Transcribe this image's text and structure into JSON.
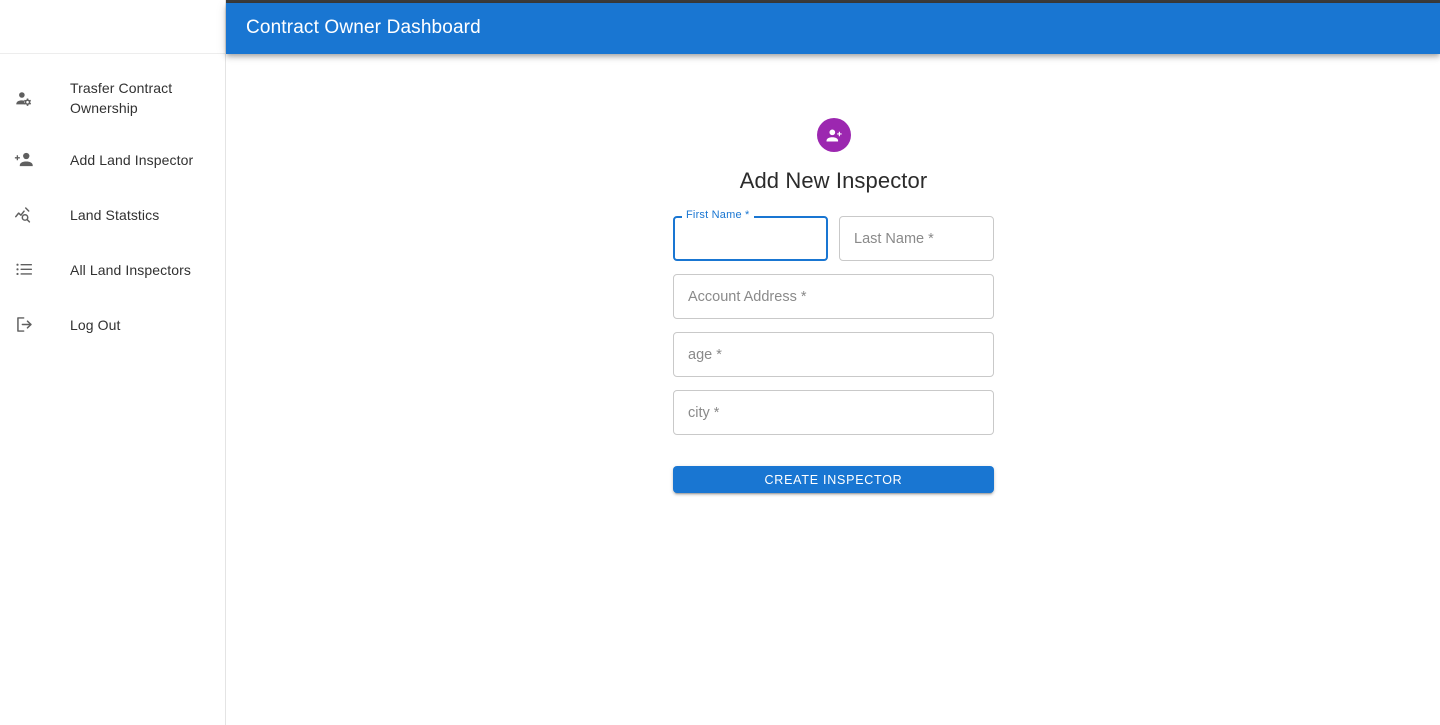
{
  "appbar": {
    "title": "Contract Owner Dashboard",
    "background_color": "#1976d2",
    "text_color": "#ffffff"
  },
  "sidebar": {
    "items": [
      {
        "label": "Trasfer Contract Ownership",
        "icon": "person-settings-icon"
      },
      {
        "label": "Add Land Inspector",
        "icon": "person-add-icon"
      },
      {
        "label": "Land Statstics",
        "icon": "analytics-search-icon"
      },
      {
        "label": "All Land Inspectors",
        "icon": "list-icon"
      },
      {
        "label": "Log Out",
        "icon": "logout-icon"
      }
    ]
  },
  "form": {
    "avatar_icon": "person-add-icon",
    "avatar_color": "#9c27b0",
    "title": "Add New Inspector",
    "fields": [
      {
        "name": "first-name",
        "label": "First Name *",
        "placeholder": "",
        "value": "",
        "focused": true
      },
      {
        "name": "last-name",
        "label": "Last Name *",
        "placeholder": "Last Name *",
        "value": "",
        "focused": false
      },
      {
        "name": "account-address",
        "label": "Account Address *",
        "placeholder": "Account Address *",
        "value": "",
        "focused": false
      },
      {
        "name": "age",
        "label": "age *",
        "placeholder": "age *",
        "value": "",
        "focused": false
      },
      {
        "name": "city",
        "label": "city *",
        "placeholder": "city *",
        "value": "",
        "focused": false
      }
    ],
    "submit_label": "CREATE INSPECTOR",
    "submit_color": "#1976d2"
  }
}
